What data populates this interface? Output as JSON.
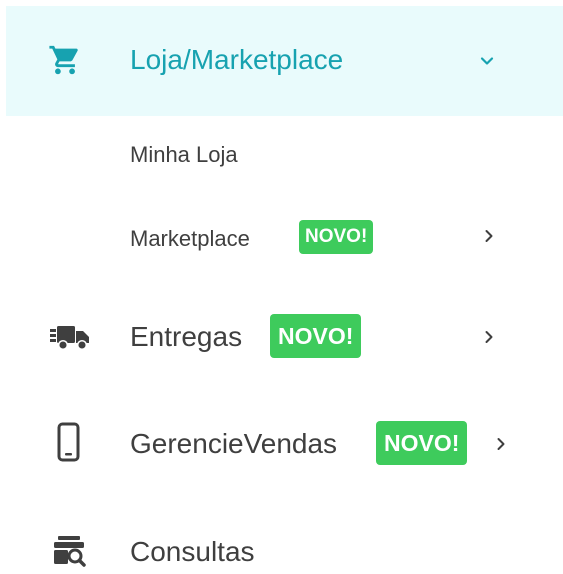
{
  "menu": {
    "marketplace": {
      "label": "Loja/Marketplace",
      "icon": "shopping-cart-icon",
      "expanded": true,
      "submenu": {
        "minha_loja": {
          "label": "Minha Loja"
        },
        "marketplace": {
          "label": "Marketplace",
          "badge": "NOVO!"
        }
      }
    },
    "entregas": {
      "label": "Entregas",
      "badge": "NOVO!",
      "icon": "truck-icon"
    },
    "gerencie_vendas": {
      "label": "GerencieVendas",
      "badge": "NOVO!",
      "icon": "smartphone-icon"
    },
    "consultas": {
      "label": "Consultas",
      "icon": "search-document-icon"
    }
  },
  "colors": {
    "active_bg": "#e9fbfc",
    "active_text": "#17a2b0",
    "text": "#3f3f3f",
    "badge": "#3ecb5c"
  }
}
